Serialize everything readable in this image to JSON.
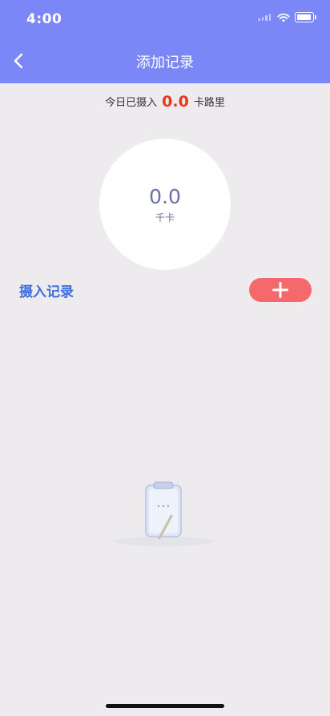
{
  "status_bar": {
    "time": "4:00"
  },
  "nav": {
    "title": "添加记录",
    "back_icon": "chevron-left-icon"
  },
  "summary": {
    "prefix": "今日已摄入",
    "value": "0.0",
    "suffix": "卡路里"
  },
  "circle": {
    "value": "0.0",
    "unit": "千卡"
  },
  "records": {
    "title": "摄入记录",
    "add_icon": "plus-icon",
    "items": []
  },
  "colors": {
    "header": "#7b87f7",
    "background": "#edebed",
    "intake_value": "#e8361e",
    "section_title": "#3d6ee0",
    "add_button": "#f4696b",
    "circle_text": "#6b6fa8"
  }
}
